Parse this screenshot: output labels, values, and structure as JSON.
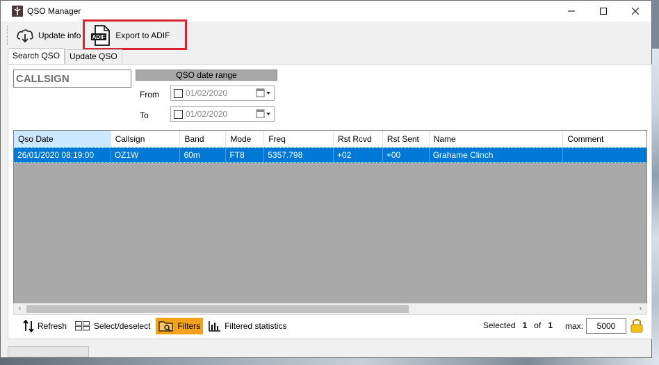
{
  "window": {
    "title": "QSO Manager",
    "app_icon": "antenna-app-icon",
    "controls": [
      "minimize-icon",
      "maximize-icon",
      "close-icon"
    ]
  },
  "toolbar": {
    "update_label": "Update info",
    "export_label": "Export to ADIF",
    "export_icon_text": "ADIF"
  },
  "tabs": [
    {
      "label": "Search QSO",
      "active": true
    },
    {
      "label": "Update QSO",
      "active": false
    }
  ],
  "search": {
    "callsign_value": "CALLSIGN",
    "range_header": "QSO date range",
    "from_label": "From",
    "to_label": "To",
    "from_value": "01/02/2020",
    "to_value": "01/02/2020"
  },
  "grid": {
    "columns": [
      "Qso Date",
      "Callsign",
      "Band",
      "Mode",
      "Freq",
      "Rst Rcvd",
      "Rst Sent",
      "Name",
      "Comment"
    ],
    "rows": [
      [
        "26/01/2020 08:19:00",
        "OZ1W",
        "60m",
        "FT8",
        "5357.798",
        "+02",
        "+00",
        "Grahame Clinch",
        ""
      ]
    ]
  },
  "bottom": {
    "refresh_label": "Refresh",
    "select_label": "Select/deselect",
    "filters_label": "Filters",
    "stats_label": "Filtered statistics",
    "selected_label": "Selected",
    "selected_count": "1",
    "of_label": "of",
    "total_count": "1",
    "max_label": "max:",
    "max_value": "5000"
  },
  "colors": {
    "selection": "#0078d7",
    "filters_active": "#f4a21a",
    "highlight_box": "#d9232d"
  }
}
